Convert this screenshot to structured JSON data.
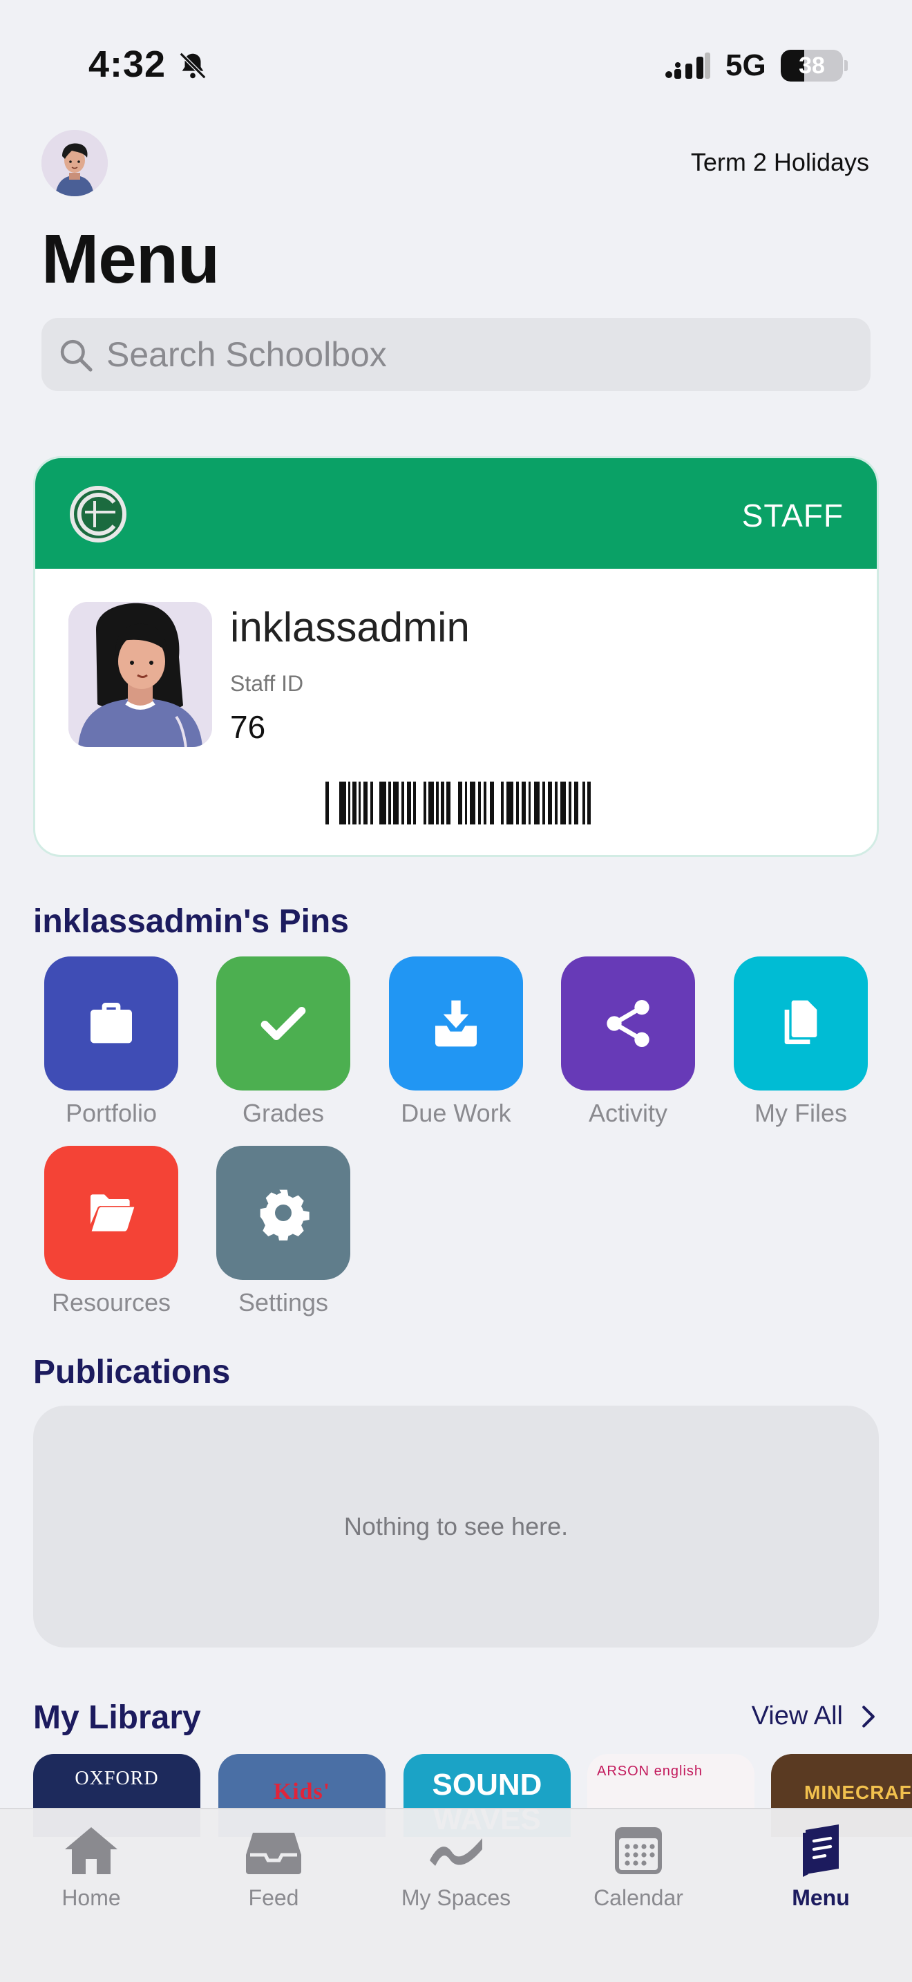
{
  "status_bar": {
    "time": "4:32",
    "network": "5G",
    "battery": "38",
    "battery_level": 0.38
  },
  "header": {
    "term": "Term 2 Holidays",
    "title": "Menu"
  },
  "search": {
    "placeholder": "Search Schoolbox"
  },
  "id_card": {
    "role": "STAFF",
    "name": "inklassadmin",
    "id_label": "Staff ID",
    "id_value": "76",
    "colors": {
      "header": "#0aa166"
    }
  },
  "pins": {
    "title": "inklassadmin's Pins",
    "items": [
      {
        "label": "Portfolio",
        "icon": "briefcase-icon",
        "color": "#3f4db5"
      },
      {
        "label": "Grades",
        "icon": "checkmark-icon",
        "color": "#4caf50"
      },
      {
        "label": "Due Work",
        "icon": "inbox-download-icon",
        "color": "#2196f3"
      },
      {
        "label": "Activity",
        "icon": "share-icon",
        "color": "#673ab7"
      },
      {
        "label": "My Files",
        "icon": "files-icon",
        "color": "#00bcd4"
      },
      {
        "label": "Resources",
        "icon": "folder-open-icon",
        "color": "#f44336"
      },
      {
        "label": "Settings",
        "icon": "gear-icon",
        "color": "#607d8b"
      }
    ]
  },
  "publications": {
    "title": "Publications",
    "empty_message": "Nothing to see here."
  },
  "library": {
    "title": "My Library",
    "view_all": "View All",
    "books": [
      {
        "cover_text": "OXFORD",
        "color": "#1d2a5c"
      },
      {
        "cover_text": "Kids'",
        "color": "#4a6fa5"
      },
      {
        "cover_text": "SOUND WAVES",
        "color": "#1ba3c6"
      },
      {
        "cover_text": "ARSON english",
        "color": "#f7f3f5"
      },
      {
        "cover_text": "MINECRAFT",
        "color": "#5a3a22"
      }
    ]
  },
  "tab_bar": {
    "items": [
      {
        "label": "Home",
        "icon": "home-icon",
        "active": false
      },
      {
        "label": "Feed",
        "icon": "inbox-tray-icon",
        "active": false
      },
      {
        "label": "My Spaces",
        "icon": "wave-icon",
        "active": false
      },
      {
        "label": "Calendar",
        "icon": "calendar-icon",
        "active": false
      },
      {
        "label": "Menu",
        "icon": "book-menu-icon",
        "active": true
      }
    ]
  }
}
